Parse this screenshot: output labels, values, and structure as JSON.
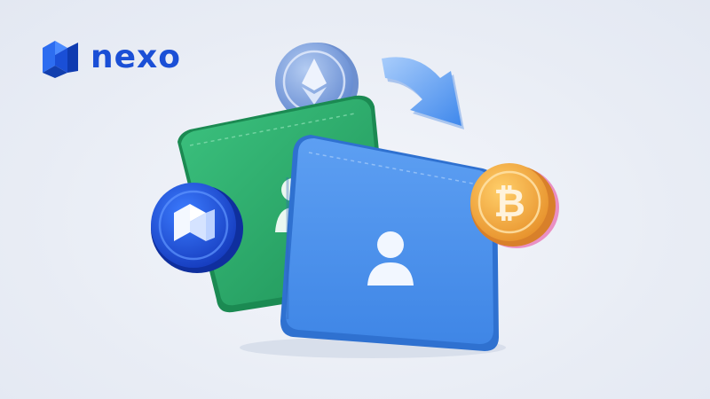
{
  "brand": {
    "name": "nexo",
    "primary_color": "#1a4fd6",
    "logo_icon": "nexo-logo-icon"
  },
  "illustration": {
    "icons": [
      "ethereum-coin-icon",
      "bitcoin-coin-icon",
      "nexo-coin-icon",
      "transfer-arrow-icon",
      "user-icon"
    ],
    "colors": {
      "green_wallet": "#26a86a",
      "blue_wallet": "#4a90e8",
      "bitcoin_coin": "#f0a53a",
      "ethereum_coin": "#7fa3de",
      "nexo_coin": "#1a4fd6"
    }
  }
}
